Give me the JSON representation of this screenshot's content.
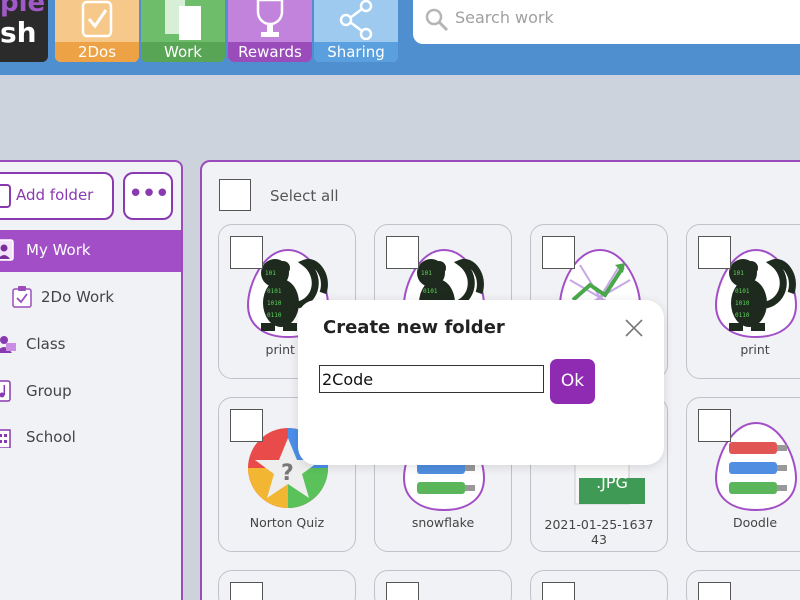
{
  "app": {
    "logo_lines": [
      "ple",
      "sh"
    ]
  },
  "nav": {
    "items": [
      {
        "label": "2Dos",
        "icon": "checklist-icon"
      },
      {
        "label": "Work",
        "icon": "documents-icon"
      },
      {
        "label": "Rewards",
        "icon": "trophy-icon"
      },
      {
        "label": "Sharing",
        "icon": "share-icon"
      }
    ]
  },
  "search": {
    "placeholder": "Search work"
  },
  "sidebar": {
    "add_folder_label": "Add folder",
    "more_label": "•••",
    "items": [
      {
        "label": "My Work",
        "active": true,
        "icon": "my-work-icon"
      },
      {
        "label": "2Do Work",
        "active": false,
        "icon": "clipboard-icon"
      },
      {
        "label": "Class",
        "active": false,
        "icon": "class-icon"
      },
      {
        "label": "Group",
        "active": false,
        "icon": "music-icon"
      },
      {
        "label": "School",
        "active": false,
        "icon": "school-icon"
      }
    ]
  },
  "main": {
    "select_all_label": "Select all",
    "cards": [
      {
        "name": "print fr",
        "thumb": "code-monkey-icon"
      },
      {
        "name": "",
        "thumb": "code-monkey-icon"
      },
      {
        "name": "",
        "thumb": "chart-egg-icon"
      },
      {
        "name": "print",
        "thumb": "code-monkey-icon"
      },
      {
        "name": "Norton Quiz",
        "thumb": "quiz-icon"
      },
      {
        "name": "snowflake",
        "thumb": "paint-tubes-icon"
      },
      {
        "name": "2021-01-25-1637\n43",
        "thumb": "jpg-file-icon"
      },
      {
        "name": "Doodle",
        "thumb": "paint-tubes-icon"
      }
    ],
    "jpg_label": ".JPG"
  },
  "dialog": {
    "title": "Create new folder",
    "input_value": "2Code",
    "ok_label": "Ok"
  },
  "colors": {
    "topbar": "#4f8fd0",
    "accent_purple": "#8f2bb3",
    "nav_2dos": "#eea246",
    "nav_work": "#57a555",
    "nav_rewards": "#9b4cbb",
    "nav_sharing": "#5aa0de"
  }
}
